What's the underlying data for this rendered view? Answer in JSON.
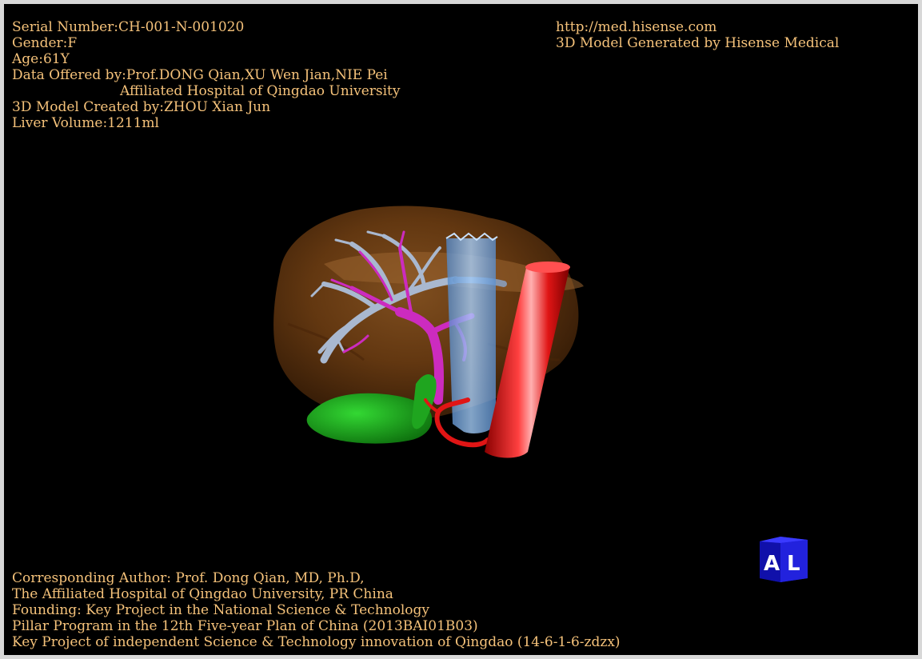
{
  "info": {
    "serial": "Serial Number:CH-001-N-001020",
    "gender": "Gender:F",
    "age": "Age:61Y",
    "data_offered": "Data Offered by:Prof.DONG Qian,XU Wen Jian,NIE Pei",
    "hospital": "Affiliated Hospital of Qingdao University",
    "created_by": "3D Model Created by:ZHOU Xian Jun",
    "liver_volume": "Liver Volume:1211ml"
  },
  "brand": {
    "url": "http://med.hisense.com",
    "generated": "3D Model Generated by Hisense Medical"
  },
  "credits": {
    "line1": "Corresponding Author: Prof. Dong Qian, MD, Ph.D,",
    "line2": "The Affiliated Hospital of Qingdao University, PR China",
    "line3": "Founding: Key Project in the National Science & Technology",
    "line4": "Pillar Program in the 12th Five-year Plan of China (2013BAI01B03)",
    "line5": "Key Project of independent Science & Technology innovation of Qingdao (14-6-1-6-zdzx)"
  },
  "orientation": {
    "face_left": "A",
    "face_right": "L"
  },
  "colors": {
    "text": "#f5c27a",
    "liver": "#7a4515",
    "hepatic_vein": "#a9b8cf",
    "portal_vein": "#cc2bbf",
    "gallbladder": "#1fa51f",
    "ivc": "#7fb6f0",
    "aorta": "#e01515",
    "cube": "#1a1acc"
  }
}
